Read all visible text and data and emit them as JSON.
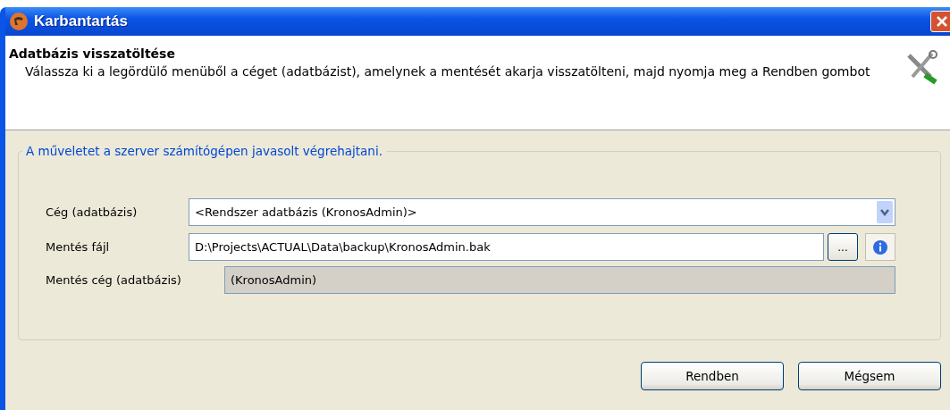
{
  "window": {
    "title": "Karbantartás"
  },
  "header": {
    "title": "Adatbázis visszatöltése",
    "description": "Válassza ki a legördülő menüből a céget (adatbázist), amelynek a mentését akarja visszatölteni, majd nyomja meg a Rendben gombot"
  },
  "group": {
    "legend": "A műveletet a szerver számítógépen javasolt végrehajtani."
  },
  "fields": [
    {
      "kind": "combo",
      "label": "Cég (adatbázis)",
      "value": "<Rendszer adatbázis (KronosAdmin)>"
    },
    {
      "kind": "file",
      "label": "Mentés fájl",
      "value": "D:\\Projects\\ACTUAL\\Data\\backup\\KronosAdmin.bak",
      "browse": "..."
    },
    {
      "kind": "readonly",
      "label": "Mentés cég (adatbázis)",
      "value": "(KronosAdmin)"
    }
  ],
  "buttons": [
    "Rendben",
    "Mégsem"
  ]
}
